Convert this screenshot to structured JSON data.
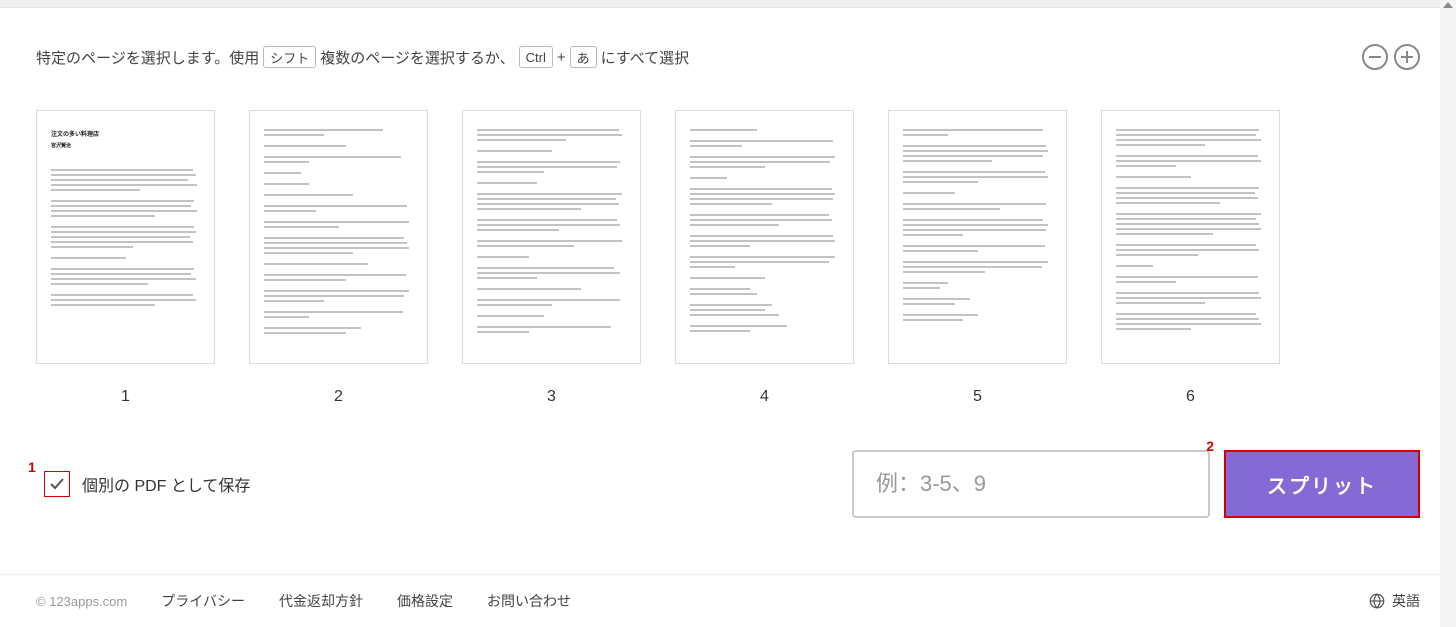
{
  "instruction": {
    "prefix": "特定のページを選択します。使用",
    "key_shift": "シフト",
    "mid1": "複数のページを選択するか、",
    "key_ctrl": "Ctrl",
    "plus": " + ",
    "key_a": "あ",
    "suffix": "にすべて選択"
  },
  "thumbs": [
    {
      "num": "1",
      "title": "注文の多い料理店",
      "subtitle": "宮沢賢治"
    },
    {
      "num": "2"
    },
    {
      "num": "3"
    },
    {
      "num": "4"
    },
    {
      "num": "5"
    },
    {
      "num": "6"
    }
  ],
  "annotations": {
    "marker1": "1",
    "marker2": "2"
  },
  "controls": {
    "checkbox_label": "個別の PDF として保存",
    "page_input_placeholder": "例：3-5、9",
    "split_label": "スプリット"
  },
  "footer": {
    "copyright": "© 123apps.com",
    "links": [
      "プライバシー",
      "代金返却方針",
      "価格設定",
      "お問い合わせ"
    ],
    "language": "英語"
  }
}
